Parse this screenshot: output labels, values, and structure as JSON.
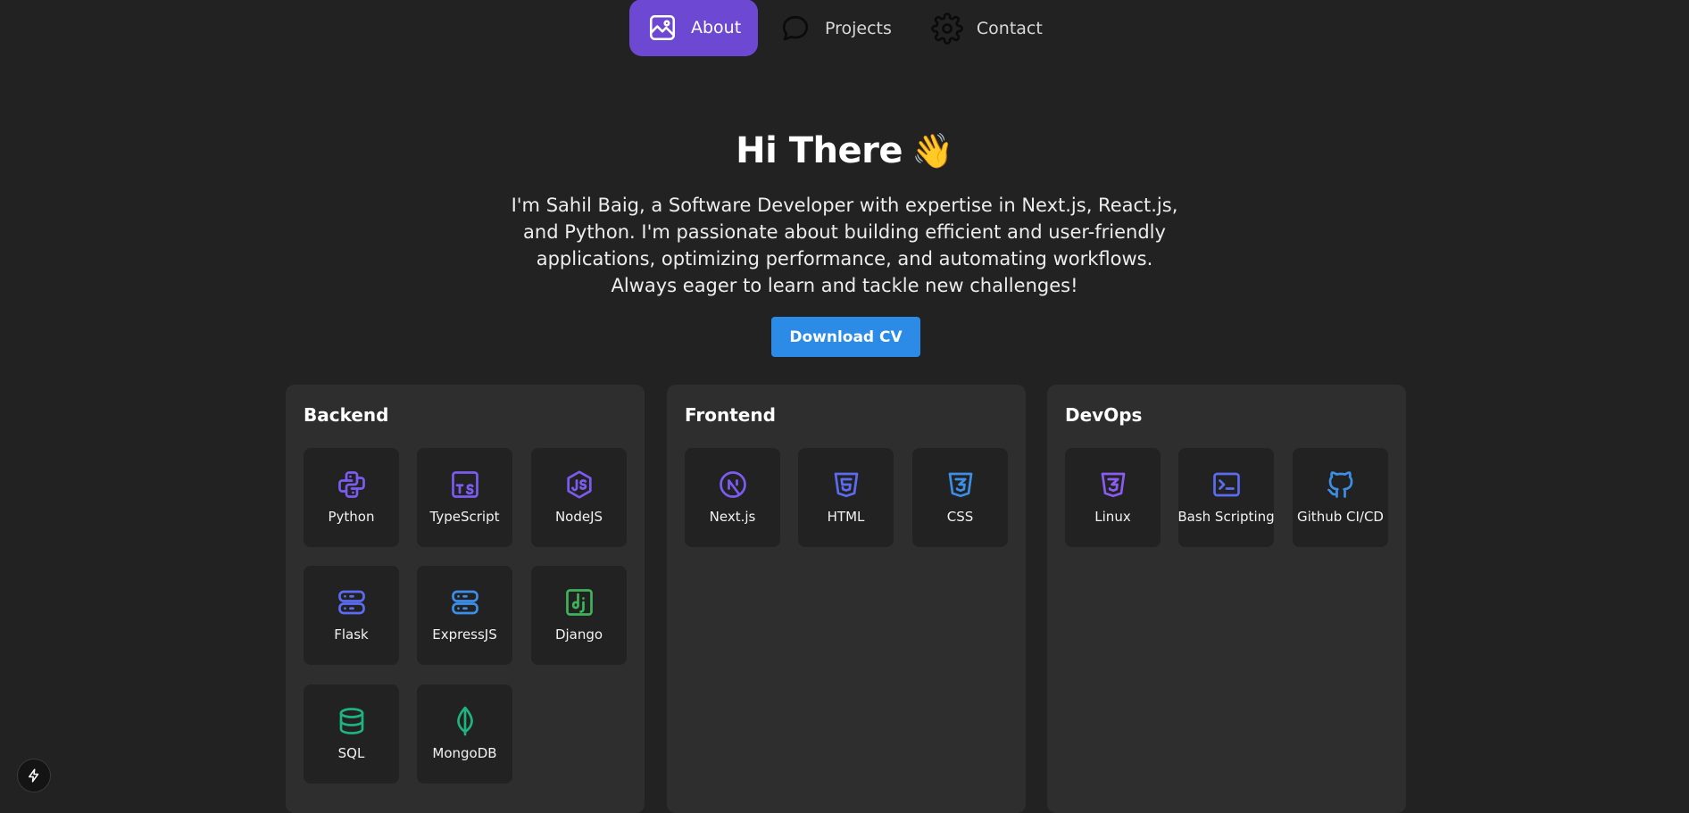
{
  "nav": {
    "items": [
      {
        "label": "About",
        "icon": "image-icon",
        "active": true
      },
      {
        "label": "Projects",
        "icon": "chat-bubble-icon",
        "active": false
      },
      {
        "label": "Contact",
        "icon": "gear-icon",
        "active": false
      }
    ]
  },
  "hero": {
    "title": "Hi There",
    "emoji": "👋",
    "description": "I'm Sahil Baig, a Software Developer with expertise in Next.js, React.js, and Python. I'm passionate about building efficient and user-friendly applications, optimizing performance, and automating workflows. Always eager to learn and tackle new challenges!",
    "cv_button": "Download CV"
  },
  "colors": {
    "background": "#222222",
    "panel": "#2e2e2e",
    "accent_purple": "#6d48d3",
    "button_blue": "#2b8be6"
  },
  "panels": {
    "backend": {
      "title": "Backend",
      "skills": [
        "Python",
        "TypeScript",
        "NodeJS",
        "Flask",
        "ExpressJS",
        "Django",
        "SQL",
        "MongoDB"
      ]
    },
    "frontend": {
      "title": "Frontend",
      "skills": [
        "Next.js",
        "HTML",
        "CSS"
      ]
    },
    "devops": {
      "title": "DevOps",
      "skills": [
        "Linux",
        "Bash Scripting",
        "Github CI/CD"
      ]
    }
  }
}
